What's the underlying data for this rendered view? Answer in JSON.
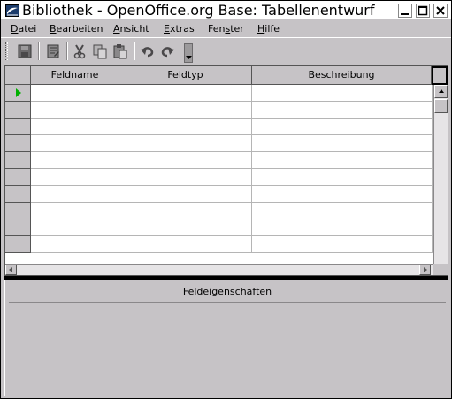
{
  "window": {
    "title": "Bibliothek - OpenOffice.org Base: Tabellenentwurf"
  },
  "menu": [
    {
      "key": "D",
      "rest": "atei"
    },
    {
      "key": "B",
      "rest": "earbeiten"
    },
    {
      "key": "A",
      "rest": "nsicht"
    },
    {
      "key": "E",
      "rest": "xtras"
    },
    {
      "pre": "Fen",
      "key": "s",
      "rest": "ter"
    },
    {
      "key": "H",
      "rest": "ilfe"
    }
  ],
  "toolbar": {
    "icons": [
      "save-icon",
      "edit-document-icon",
      "cut-icon",
      "copy-icon",
      "paste-icon",
      "undo-icon",
      "redo-icon"
    ]
  },
  "grid": {
    "columns": [
      "Feldname",
      "Feldtyp",
      "Beschreibung"
    ],
    "row_count": 10,
    "current_row": 0
  },
  "properties": {
    "title": "Feldeigenschaften"
  },
  "colors": {
    "row_marker": "#00b000",
    "chrome": "#c6c3c6"
  }
}
